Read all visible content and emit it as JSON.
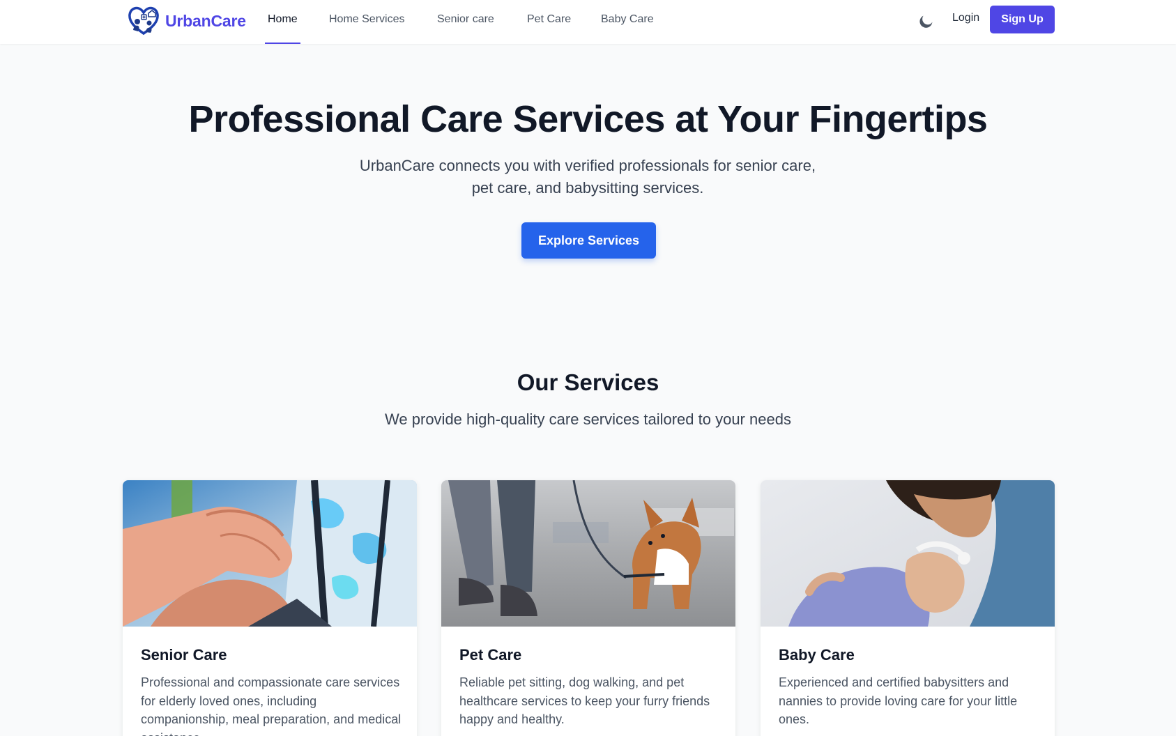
{
  "nav": {
    "brand": "UrbanCare",
    "links": [
      "Home",
      "Home Services",
      "Senior care",
      "Pet Care",
      "Baby Care"
    ],
    "active": "Home",
    "login": "Login",
    "signup": "Sign Up"
  },
  "hero": {
    "title": "Professional Care Services at Your Fingertips",
    "subtitle_line1": "UrbanCare connects you with verified professionals for senior care,",
    "subtitle_line2": "pet care, and babysitting services.",
    "cta": "Explore Services"
  },
  "services": {
    "title": "Our Services",
    "subtitle": "We provide high-quality care services tailored to your needs",
    "cards": [
      {
        "title": "Senior Care",
        "description": "Professional and compassionate care services for elderly loved ones, including companionship, meal preparation, and medical assistance."
      },
      {
        "title": "Pet Care",
        "description": "Reliable pet sitting, dog walking, and pet healthcare services to keep your furry friends happy and healthy."
      },
      {
        "title": "Baby Care",
        "description": "Experienced and certified babysitters and nannies to provide loving care for your little ones."
      }
    ]
  },
  "colors": {
    "brand": "#4f46e5",
    "primary_button": "#2563eb",
    "page_background": "#f9fafb",
    "heading": "#111827",
    "body_text": "#4b5563"
  },
  "icons": [
    "heart-hands-logo-icon",
    "moon-icon"
  ]
}
